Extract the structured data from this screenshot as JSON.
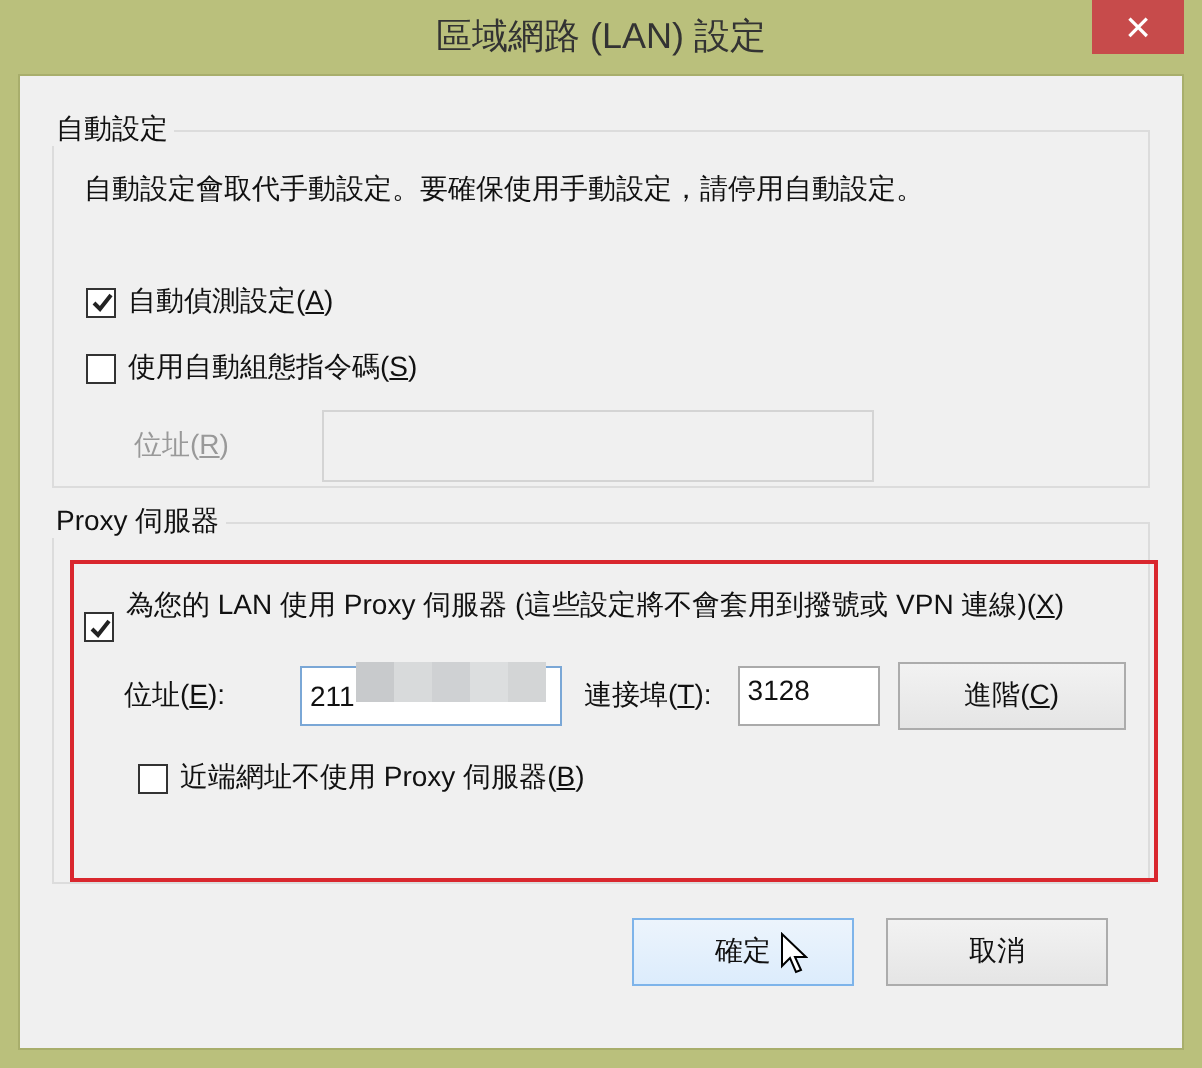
{
  "window": {
    "title": "區域網路 (LAN) 設定",
    "close": "×"
  },
  "auto_config": {
    "title": "自動設定",
    "description": "自動設定會取代手動設定。要確保使用手動設定，請停用自動設定。",
    "options": [
      {
        "label": "自動偵測設定(A)",
        "checked": true
      },
      {
        "label": "使用自動組態指令碼(S)",
        "checked": false
      }
    ],
    "address": {
      "label": "位址(R)",
      "disabled": true
    }
  },
  "proxy": {
    "title": "Proxy 伺服器",
    "highlighted": true,
    "use_proxy": {
      "label": "為您的 LAN 使用 Proxy 伺服器 (這些設定將不會套用到撥號或 VPN 連線)(X)",
      "checked": true
    },
    "address": {
      "label": "位址(E):",
      "value": "211",
      "redacted": true
    },
    "port": {
      "label": "連接埠(T):",
      "value": "3128"
    },
    "advanced_button": "進階(C)",
    "bypass_local": {
      "label": "近端網址不使用 Proxy 伺服器(B)",
      "checked": false
    }
  },
  "buttons": [
    {
      "label": "確定",
      "hovered": true
    },
    {
      "label": "取消",
      "hovered": false
    }
  ]
}
